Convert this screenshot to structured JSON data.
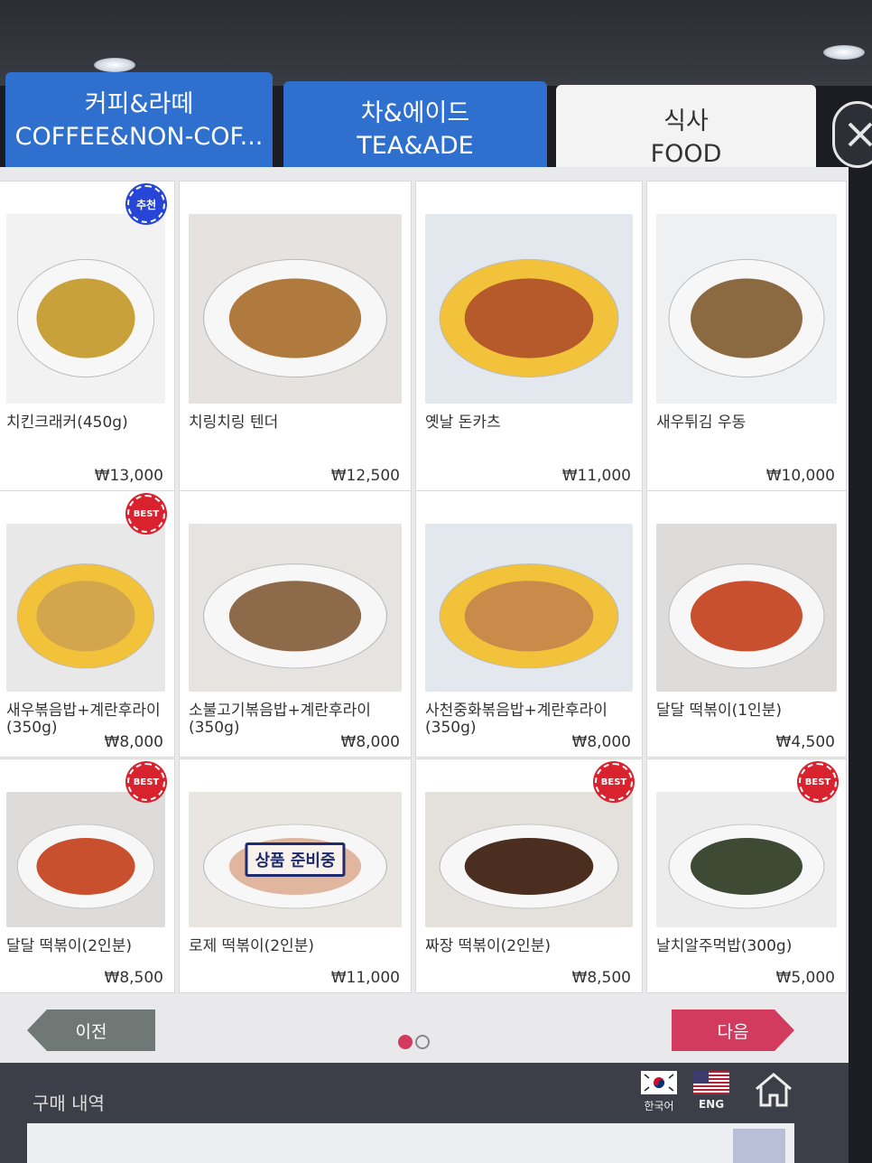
{
  "tabs": [
    {
      "line1": "커피&라떼",
      "line2": "COFFEE&NON-COF...",
      "active": false
    },
    {
      "line1": "차&에이드",
      "line2": "TEA&ADE",
      "active": false
    },
    {
      "line1": "식사",
      "line2": "FOOD",
      "active": true
    }
  ],
  "close": {
    "icon": "close-icon"
  },
  "menu": [
    {
      "name": "치킨크래커(450g)",
      "price": "₩13,000",
      "badge": "추천"
    },
    {
      "name": "치링치링 텐더",
      "price": "₩12,500",
      "badge": ""
    },
    {
      "name": "옛날 돈카츠",
      "price": "₩11,000",
      "badge": ""
    },
    {
      "name": "새우튀김 우동",
      "price": "₩10,000",
      "badge": ""
    },
    {
      "name": "새우볶음밥+계란후라이 (350g)",
      "price": "₩8,000",
      "badge": "BEST"
    },
    {
      "name": "소불고기볶음밥+계란후라이 (350g)",
      "price": "₩8,000",
      "badge": ""
    },
    {
      "name": "사천중화볶음밥+계란후라이 (350g)",
      "price": "₩8,000",
      "badge": ""
    },
    {
      "name": "달달 떡볶이(1인분)",
      "price": "₩4,500",
      "badge": ""
    },
    {
      "name": "달달 떡볶이(2인분)",
      "price": "₩8,500",
      "badge": "BEST"
    },
    {
      "name": "로제 떡볶이(2인분)",
      "price": "₩11,000",
      "badge": "",
      "stamp": "상품 준비중"
    },
    {
      "name": "짜장 떡볶이(2인분)",
      "price": "₩8,500",
      "badge": "BEST"
    },
    {
      "name": "날치알주먹밥(300g)",
      "price": "₩5,000",
      "badge": "BEST"
    }
  ],
  "nav": {
    "prev": "이전",
    "next": "다음",
    "page": 1,
    "pages": 2
  },
  "footer": {
    "history_label": "구매 내역",
    "lang_ko": "한국어",
    "lang_en": "ENG",
    "home_icon": "home-icon"
  },
  "colors": {
    "tab_blue": "#2f6fce",
    "best_red": "#d8222e",
    "recommend_blue": "#2745d6",
    "next_pink": "#d23a5e",
    "prev_gray": "#6f7874"
  }
}
